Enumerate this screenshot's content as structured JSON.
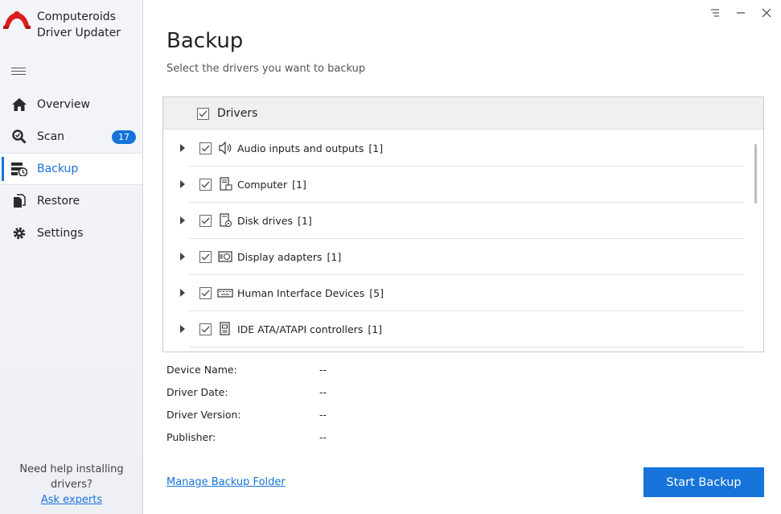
{
  "app": {
    "name_line1": "Computeroids",
    "name_line2": "Driver Updater"
  },
  "sidebar": {
    "items": [
      {
        "label": "Overview",
        "icon": "home-icon"
      },
      {
        "label": "Scan",
        "icon": "scan-icon",
        "badge": "17"
      },
      {
        "label": "Backup",
        "icon": "backup-icon",
        "active": true
      },
      {
        "label": "Restore",
        "icon": "restore-icon"
      },
      {
        "label": "Settings",
        "icon": "gear-icon"
      }
    ],
    "help_text_line1": "Need help installing",
    "help_text_line2": "drivers?",
    "help_link": "Ask experts"
  },
  "main": {
    "title": "Backup",
    "subtitle": "Select the drivers you want to backup",
    "list_header": "Drivers",
    "rows": [
      {
        "label": "Audio inputs and outputs",
        "count": "[1]",
        "icon": "speaker-icon",
        "checked": true
      },
      {
        "label": "Computer",
        "count": "[1]",
        "icon": "computer-icon",
        "checked": true
      },
      {
        "label": "Disk drives",
        "count": "[1]",
        "icon": "disk-drive-icon",
        "checked": true
      },
      {
        "label": "Display adapters",
        "count": "[1]",
        "icon": "display-adapter-icon",
        "checked": true
      },
      {
        "label": "Human Interface Devices",
        "count": "[5]",
        "icon": "keyboard-icon",
        "checked": true
      },
      {
        "label": "IDE ATA/ATAPI controllers",
        "count": "[1]",
        "icon": "ide-controller-icon",
        "checked": true
      }
    ],
    "details": {
      "device_name_label": "Device Name:",
      "device_name_value": "--",
      "driver_date_label": "Driver Date:",
      "driver_date_value": "--",
      "driver_version_label": "Driver Version:",
      "driver_version_value": "--",
      "publisher_label": "Publisher:",
      "publisher_value": "--"
    },
    "manage_link": "Manage Backup Folder",
    "start_button": "Start Backup"
  },
  "colors": {
    "accent": "#1673d9",
    "logo_red": "#d81e1e"
  }
}
